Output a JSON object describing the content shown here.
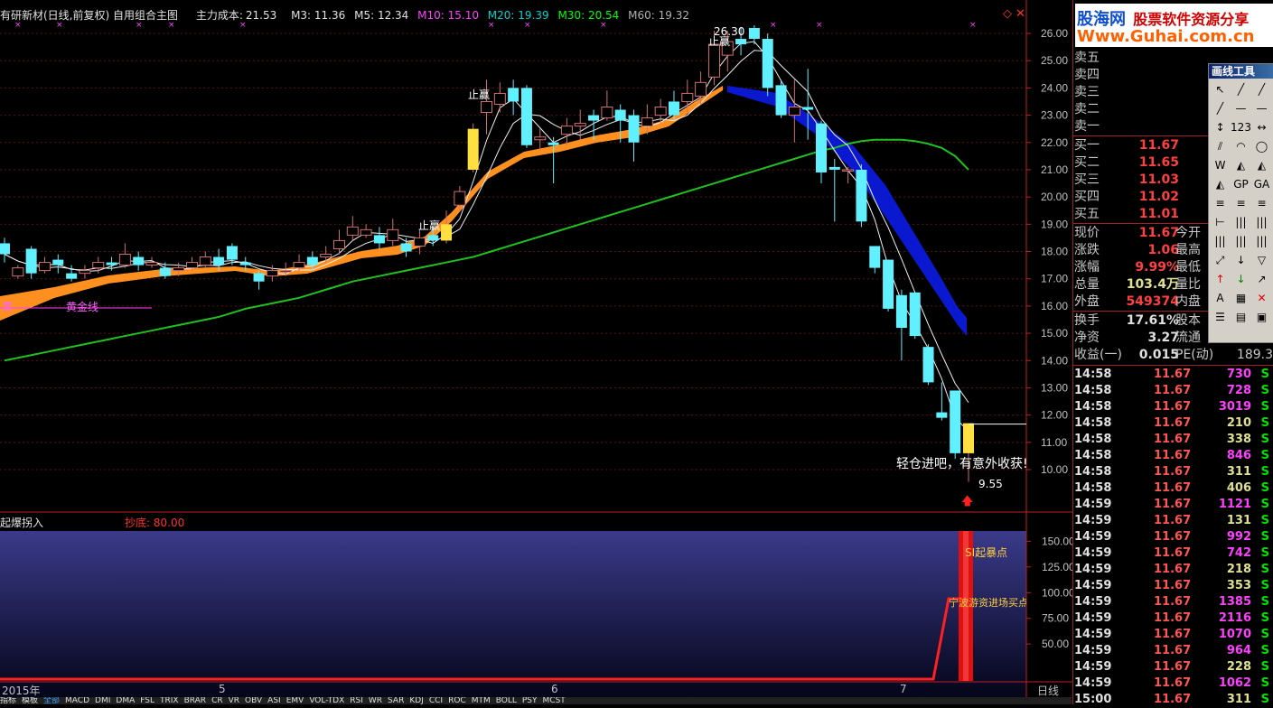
{
  "title_bar": {
    "stock": "有研新材(日线,前复权) 自用组合主图",
    "main_cost_label": "主力成本:",
    "main_cost": "21.53",
    "m3": "M3: 11.36",
    "m5": "M5: 12.34",
    "m10": "M10: 15.10",
    "m20": "M20: 19.39",
    "m30": "M30: 20.54",
    "m60": "M60: 19.32",
    "m10_color": "#ff00ff",
    "m20_color": "#00d0d0",
    "m30_color": "#00ff00",
    "m60_color": "#c0c0c0"
  },
  "main_labels": {
    "stop1": "止赢",
    "stop2": "止赢",
    "stop3": "止赢",
    "high_value": "26.30",
    "low_value": "9.55",
    "golden_line": "黄金线",
    "golden_mark": "黄",
    "advice": "轻仓进吧，有意外收获!"
  },
  "price_axis": [
    "26.00",
    "25.00",
    "24.00",
    "23.00",
    "22.00",
    "21.00",
    "20.00",
    "19.00",
    "18.00",
    "17.00",
    "16.00",
    "15.00",
    "14.00",
    "13.00",
    "12.00",
    "11.00",
    "10.00"
  ],
  "sub_chart": {
    "title": "起爆拐入",
    "value_label": "抄底: 80.00",
    "axis": [
      "150.00",
      "125.00",
      "100.00",
      "75.00",
      "50.00"
    ],
    "signal_top": "SI起暴点",
    "signal_mid": "宁波游资进场买点"
  },
  "date_axis": {
    "year": "2015年",
    "m5": "5",
    "m6": "6",
    "m7": "7",
    "period": "日线"
  },
  "chart_data": {
    "type": "candlestick",
    "title": "有研新材(日线,前复权)",
    "ylim": [
      9.2,
      26.8
    ],
    "candles": [
      {
        "o": 18.3,
        "c": 17.9,
        "h": 18.5,
        "l": 17.6
      },
      {
        "o": 17.1,
        "c": 17.4,
        "h": 17.5,
        "l": 17.0
      },
      {
        "o": 18.1,
        "c": 17.2,
        "h": 18.2,
        "l": 17.0
      },
      {
        "o": 17.3,
        "c": 17.6,
        "h": 17.8,
        "l": 17.2
      },
      {
        "o": 17.7,
        "c": 17.5,
        "h": 17.9,
        "l": 17.2
      },
      {
        "o": 17.2,
        "c": 17.0,
        "h": 17.5,
        "l": 16.9
      },
      {
        "o": 17.2,
        "c": 17.3,
        "h": 17.5,
        "l": 17.0
      },
      {
        "o": 17.4,
        "c": 17.6,
        "h": 17.8,
        "l": 17.2
      },
      {
        "o": 17.6,
        "c": 17.5,
        "h": 17.8,
        "l": 17.3
      },
      {
        "o": 17.5,
        "c": 17.9,
        "h": 18.3,
        "l": 17.4
      },
      {
        "o": 17.8,
        "c": 17.5,
        "h": 18.0,
        "l": 17.3
      },
      {
        "o": 17.5,
        "c": 17.6,
        "h": 17.8,
        "l": 17.4
      },
      {
        "o": 17.4,
        "c": 17.1,
        "h": 17.6,
        "l": 17.0
      },
      {
        "o": 17.3,
        "c": 17.4,
        "h": 17.6,
        "l": 17.1
      },
      {
        "o": 17.4,
        "c": 17.6,
        "h": 17.8,
        "l": 17.3
      },
      {
        "o": 17.5,
        "c": 17.8,
        "h": 18.0,
        "l": 17.4
      },
      {
        "o": 17.8,
        "c": 17.5,
        "h": 18.1,
        "l": 17.3
      },
      {
        "o": 18.2,
        "c": 17.7,
        "h": 18.3,
        "l": 17.5
      },
      {
        "o": 17.6,
        "c": 17.5,
        "h": 17.8,
        "l": 17.3
      },
      {
        "o": 17.2,
        "c": 16.9,
        "h": 17.3,
        "l": 16.6
      },
      {
        "o": 17.1,
        "c": 17.3,
        "h": 17.5,
        "l": 16.9
      },
      {
        "o": 17.3,
        "c": 17.3,
        "h": 17.6,
        "l": 17.1
      },
      {
        "o": 17.4,
        "c": 17.6,
        "h": 17.9,
        "l": 17.3
      },
      {
        "o": 17.8,
        "c": 17.5,
        "h": 18.0,
        "l": 17.3
      },
      {
        "o": 17.8,
        "c": 17.9,
        "h": 18.2,
        "l": 17.6
      },
      {
        "o": 18.1,
        "c": 18.4,
        "h": 18.8,
        "l": 17.9
      },
      {
        "o": 18.6,
        "c": 18.9,
        "h": 19.3,
        "l": 18.4
      },
      {
        "o": 18.6,
        "c": 18.8,
        "h": 19.0,
        "l": 18.5
      },
      {
        "o": 18.6,
        "c": 18.3,
        "h": 18.9,
        "l": 18.1
      },
      {
        "o": 18.4,
        "c": 18.8,
        "h": 19.2,
        "l": 18.2
      },
      {
        "o": 18.3,
        "c": 18.0,
        "h": 18.5,
        "l": 17.8
      },
      {
        "o": 18.2,
        "c": 18.5,
        "h": 18.8,
        "l": 17.9
      },
      {
        "o": 18.6,
        "c": 18.4,
        "h": 18.9,
        "l": 18.2
      },
      {
        "o": 18.4,
        "c": 19.0,
        "h": 19.5,
        "l": 18.3
      },
      {
        "o": 19.7,
        "c": 20.2,
        "h": 20.4,
        "l": 19.5
      },
      {
        "o": 21.0,
        "c": 22.5,
        "h": 22.7,
        "l": 20.9
      },
      {
        "o": 23.1,
        "c": 23.5,
        "h": 24.3,
        "l": 22.3
      },
      {
        "o": 23.4,
        "c": 23.8,
        "h": 24.2,
        "l": 23.1
      },
      {
        "o": 24.0,
        "c": 23.5,
        "h": 24.3,
        "l": 23.0
      },
      {
        "o": 24.0,
        "c": 21.9,
        "h": 24.1,
        "l": 21.8
      },
      {
        "o": 22.1,
        "c": 22.2,
        "h": 22.5,
        "l": 21.7
      },
      {
        "o": 22.0,
        "c": 21.9,
        "h": 22.2,
        "l": 20.5
      },
      {
        "o": 22.3,
        "c": 22.6,
        "h": 22.9,
        "l": 21.9
      },
      {
        "o": 22.6,
        "c": 22.7,
        "h": 23.2,
        "l": 22.1
      },
      {
        "o": 23.0,
        "c": 22.8,
        "h": 23.2,
        "l": 22.1
      },
      {
        "o": 22.9,
        "c": 23.3,
        "h": 23.9,
        "l": 22.8
      },
      {
        "o": 23.2,
        "c": 22.8,
        "h": 23.4,
        "l": 22.0
      },
      {
        "o": 23.0,
        "c": 22.0,
        "h": 23.2,
        "l": 21.3
      },
      {
        "o": 22.6,
        "c": 22.9,
        "h": 23.4,
        "l": 22.3
      },
      {
        "o": 23.0,
        "c": 23.3,
        "h": 23.6,
        "l": 22.7
      },
      {
        "o": 23.5,
        "c": 23.0,
        "h": 23.9,
        "l": 22.8
      },
      {
        "o": 23.5,
        "c": 23.8,
        "h": 24.3,
        "l": 23.1
      },
      {
        "o": 23.7,
        "c": 24.2,
        "h": 24.6,
        "l": 23.4
      },
      {
        "o": 24.4,
        "c": 25.6,
        "h": 26.1,
        "l": 24.1
      },
      {
        "o": 25.2,
        "c": 25.7,
        "h": 26.1,
        "l": 24.6
      },
      {
        "o": 25.8,
        "c": 25.6,
        "h": 26.2,
        "l": 25.2
      },
      {
        "o": 26.2,
        "c": 25.8,
        "h": 26.3,
        "l": 25.6
      },
      {
        "o": 25.8,
        "c": 24.0,
        "h": 26.0,
        "l": 23.7
      },
      {
        "o": 24.1,
        "c": 23.0,
        "h": 24.3,
        "l": 22.9
      },
      {
        "o": 23.0,
        "c": 23.3,
        "h": 24.3,
        "l": 22.0
      },
      {
        "o": 23.3,
        "c": 23.2,
        "h": 24.7,
        "l": 22.1
      },
      {
        "o": 22.7,
        "c": 20.9,
        "h": 22.8,
        "l": 20.5
      },
      {
        "o": 21.1,
        "c": 21.0,
        "h": 21.4,
        "l": 19.1
      },
      {
        "o": 21.0,
        "c": 21.0,
        "h": 21.1,
        "l": 20.5
      },
      {
        "o": 21.0,
        "c": 19.1,
        "h": 21.2,
        "l": 18.9
      },
      {
        "o": 18.2,
        "c": 17.4,
        "h": 18.2,
        "l": 17.2
      },
      {
        "o": 17.7,
        "c": 15.9,
        "h": 17.7,
        "l": 15.8
      },
      {
        "o": 16.4,
        "c": 15.2,
        "h": 16.6,
        "l": 14.0
      },
      {
        "o": 16.5,
        "c": 14.9,
        "h": 16.5,
        "l": 14.8
      },
      {
        "o": 14.5,
        "c": 13.2,
        "h": 14.6,
        "l": 13.1
      },
      {
        "o": 12.1,
        "c": 11.9,
        "h": 13.2,
        "l": 11.8
      },
      {
        "o": 12.9,
        "c": 10.6,
        "h": 12.9,
        "l": 10.4
      },
      {
        "o": 10.6,
        "c": 11.7,
        "h": 11.7,
        "l": 9.55
      }
    ],
    "series": [
      {
        "name": "M60",
        "color": "#20c020",
        "values": [
          14.0,
          14.1,
          14.2,
          14.3,
          14.4,
          14.5,
          14.6,
          14.7,
          14.8,
          14.9,
          15.0,
          15.1,
          15.2,
          15.3,
          15.4,
          15.5,
          15.6,
          15.75,
          15.9,
          16.0,
          16.1,
          16.2,
          16.3,
          16.45,
          16.6,
          16.75,
          16.9,
          17.0,
          17.1,
          17.2,
          17.3,
          17.4,
          17.5,
          17.6,
          17.7,
          17.8,
          17.95,
          18.1,
          18.25,
          18.4,
          18.55,
          18.7,
          18.85,
          19.0,
          19.15,
          19.3,
          19.45,
          19.6,
          19.75,
          19.9,
          20.05,
          20.2,
          20.35,
          20.5,
          20.65,
          20.8,
          20.95,
          21.1,
          21.25,
          21.4,
          21.55,
          21.7,
          21.8,
          21.95,
          22.05,
          22.1,
          22.1,
          22.1,
          22.05,
          21.95,
          21.8,
          21.5,
          21.0
        ]
      }
    ]
  },
  "quote": {
    "ask5": "卖五",
    "ask4": "卖四",
    "ask3": "卖三",
    "ask2": "卖二",
    "ask1": "卖一",
    "bid1": "买一",
    "bid1_v": "11.67",
    "bid2": "买二",
    "bid2_v": "11.65",
    "bid3": "买三",
    "bid3_v": "11.03",
    "bid4": "买四",
    "bid4_v": "11.02",
    "bid5": "买五",
    "bid5_v": "11.01",
    "price": "现价",
    "price_v": "11.67",
    "open": "今开",
    "chg": "涨跌",
    "chg_v": "1.06",
    "high": "最高",
    "pct": "涨幅",
    "pct_v": "9.99%",
    "low": "最低",
    "vol": "总量",
    "vol_v": "103.4万",
    "vr": "量比",
    "outer": "外盘",
    "outer_v": "549374",
    "inner": "内盘",
    "turnover": "换手",
    "turnover_v": "17.61%",
    "equity": "股本",
    "nav": "净资",
    "nav_v": "3.27",
    "float": "流通",
    "eps": "收益(一)",
    "eps_v": "0.015",
    "pe": "PE(动)",
    "pe_v": "189.3"
  },
  "ticks": [
    {
      "t": "14:58",
      "p": "11.67",
      "v": "730",
      "c": "#ff40ff"
    },
    {
      "t": "14:58",
      "p": "11.67",
      "v": "728",
      "c": "#ff40ff"
    },
    {
      "t": "14:58",
      "p": "11.67",
      "v": "3019",
      "c": "#ff40ff"
    },
    {
      "t": "14:58",
      "p": "11.67",
      "v": "210",
      "c": "#e0e090"
    },
    {
      "t": "14:58",
      "p": "11.67",
      "v": "338",
      "c": "#e0e090"
    },
    {
      "t": "14:58",
      "p": "11.67",
      "v": "846",
      "c": "#ff40ff"
    },
    {
      "t": "14:58",
      "p": "11.67",
      "v": "311",
      "c": "#e0e090"
    },
    {
      "t": "14:58",
      "p": "11.67",
      "v": "406",
      "c": "#e0e090"
    },
    {
      "t": "14:59",
      "p": "11.67",
      "v": "1121",
      "c": "#ff40ff"
    },
    {
      "t": "14:59",
      "p": "11.67",
      "v": "131",
      "c": "#e0e090"
    },
    {
      "t": "14:59",
      "p": "11.67",
      "v": "992",
      "c": "#ff40ff"
    },
    {
      "t": "14:59",
      "p": "11.67",
      "v": "742",
      "c": "#ff40ff"
    },
    {
      "t": "14:59",
      "p": "11.67",
      "v": "218",
      "c": "#e0e090"
    },
    {
      "t": "14:59",
      "p": "11.67",
      "v": "353",
      "c": "#e0e090"
    },
    {
      "t": "14:59",
      "p": "11.67",
      "v": "1385",
      "c": "#ff40ff"
    },
    {
      "t": "14:59",
      "p": "11.67",
      "v": "2116",
      "c": "#ff40ff"
    },
    {
      "t": "14:59",
      "p": "11.67",
      "v": "1070",
      "c": "#ff40ff"
    },
    {
      "t": "14:59",
      "p": "11.67",
      "v": "964",
      "c": "#ff40ff"
    },
    {
      "t": "14:59",
      "p": "11.67",
      "v": "228",
      "c": "#e0e090"
    },
    {
      "t": "14:59",
      "p": "11.67",
      "v": "1062",
      "c": "#ff40ff"
    },
    {
      "t": "15:00",
      "p": "11.67",
      "v": "311",
      "c": "#e0e090"
    }
  ],
  "guhai": {
    "name": "股海网",
    "slogan": "股票软件资源分享",
    "url": "Www.Guhai.com.cn"
  },
  "toolbox": {
    "title": "画线工具",
    "tools": [
      "↖",
      "╱",
      "╱",
      "╱",
      "—",
      "—",
      "↕",
      "123",
      "↔",
      "⫽",
      "◠",
      "◯",
      "W",
      "◭",
      "◭",
      "◭",
      "GP",
      "GA",
      "≡",
      "≡",
      "≡",
      "⊢",
      "|||",
      "|||",
      "|||",
      "|||",
      "|||",
      "⤢",
      "↓",
      "▽",
      "↑",
      "↓",
      "↗",
      "A",
      "▦",
      "✕",
      "☰",
      "▤",
      "▣"
    ]
  },
  "bottom_tabs": [
    "指标",
    "模板",
    "全部",
    "MACD",
    "DMI",
    "DMA",
    "FSL",
    "TRIX",
    "BRAR",
    "CR",
    "VR",
    "OBV",
    "ASI",
    "EMV",
    "VOL-TDX",
    "RSI",
    "WR",
    "SAR",
    "KDJ",
    "CCI",
    "ROC",
    "MTM",
    "BOLL",
    "PSY",
    "MCST"
  ]
}
